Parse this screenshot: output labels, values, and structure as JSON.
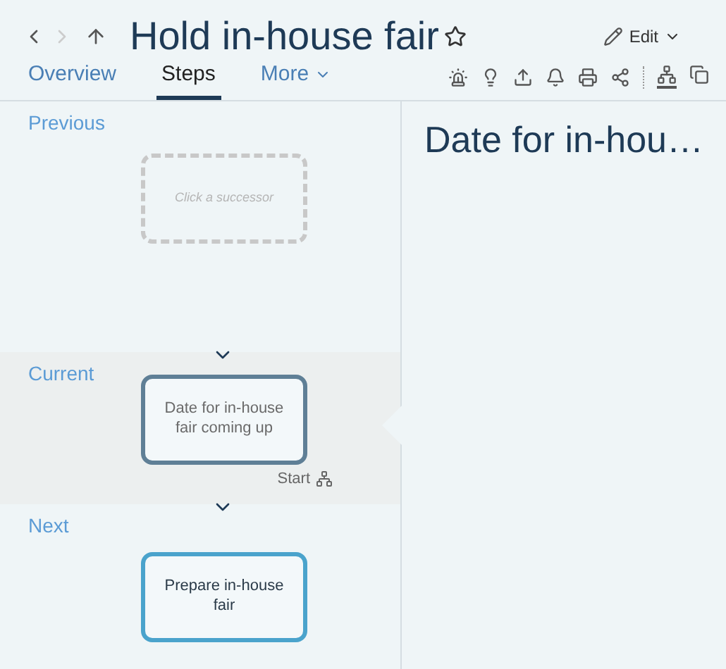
{
  "header": {
    "title": "Hold in-house fair",
    "favorite": false,
    "back_enabled": true,
    "forward_enabled": false,
    "edit": "Edit"
  },
  "tabs": [
    {
      "label": "Overview",
      "selected": false,
      "dropdown": false
    },
    {
      "label": "Steps",
      "selected": true,
      "dropdown": false
    },
    {
      "label": "More",
      "selected": false,
      "dropdown": true
    }
  ],
  "views": [
    {
      "selected": true
    },
    {
      "selected": false
    }
  ],
  "sections": [
    {
      "heading": "Previous",
      "kind": "placeholder",
      "step": "Click a successor"
    },
    {
      "heading": "Current",
      "kind": "current",
      "step": "Date for in-house fair coming up",
      "action": "Start"
    },
    {
      "heading": "Next",
      "kind": "next",
      "step": "Prepare in-house fair"
    }
  ],
  "detail": {
    "title": "Date for in-hou…"
  }
}
